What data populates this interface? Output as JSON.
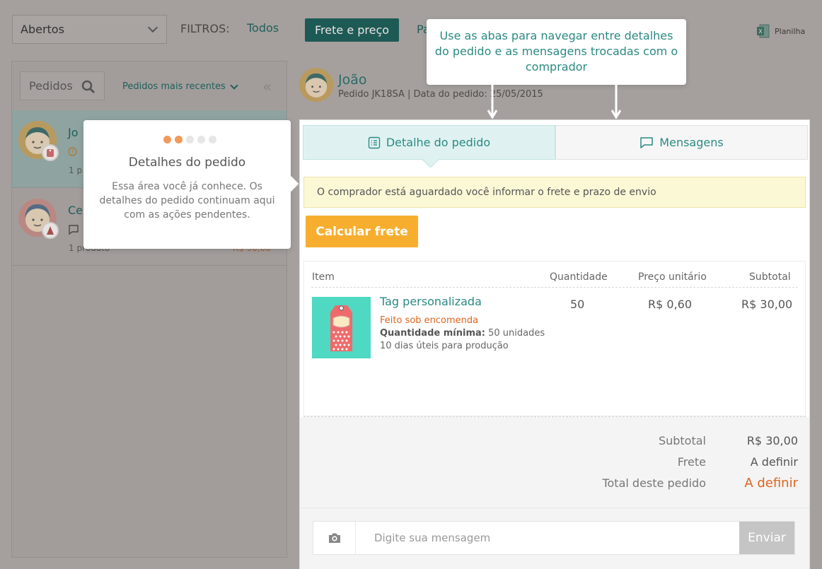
{
  "top_bar": {
    "status_select": "Abertos",
    "filters_label": "FILTROS:",
    "filter_all": "Todos",
    "filter_active": "Frete e preço",
    "filter_partial": "Pa",
    "spreadsheet_link": "Planilha"
  },
  "orders_panel": {
    "search_label": "Pedidos",
    "sort_label": "Pedidos mais recentes",
    "collapse_icon": "double-chevron-left-icon",
    "orders": [
      {
        "name_partial": "Jo",
        "status_icon": "?",
        "items_partial": "1 p",
        "price": ""
      },
      {
        "name_partial": "Ce",
        "status_icon": "chat-icon",
        "items_partial": "1 produto",
        "price": "R$ 90,00"
      }
    ]
  },
  "order_header": {
    "buyer_name": "João",
    "order_meta": "Pedido JK18SA | Data do pedido: 25/05/2015"
  },
  "tabs": {
    "details": "Detalhe do pedido",
    "messages": "Mensagens"
  },
  "notice": "O comprador está aguardado você informar o frete e prazo de envio",
  "calc_button": "Calcular frete",
  "table": {
    "headers": {
      "item": "Item",
      "quantity": "Quantidade",
      "unit_price": "Preço unitário",
      "subtotal": "Subtotal"
    },
    "rows": [
      {
        "name": "Tag personalizada",
        "made_to_order": "Feito sob encomenda",
        "min_label": "Quantidade mínima:",
        "min_value": "50 unidades",
        "production": "10 dias úteis para produção",
        "quantity": "50",
        "unit_price": "R$ 0,60",
        "subtotal": "R$ 30,00"
      }
    ]
  },
  "totals": {
    "subtotal_label": "Subtotal",
    "subtotal_value": "R$ 30,00",
    "shipping_label": "Frete",
    "shipping_value": "A definir",
    "total_label": "Total deste pedido",
    "total_value": "A definir"
  },
  "message": {
    "placeholder": "Digite sua mensagem",
    "send": "Enviar"
  },
  "tooltip_left": {
    "step": 2,
    "total_steps": 5,
    "title": "Detalhes do pedido",
    "body": "Essa área você já conhece. Os detalhes do pedido continuam aqui com as ações pendentes."
  },
  "tooltip_top": {
    "text": "Use as abas para navegar entre detalhes do pedido e as mensagens trocadas com o comprador"
  },
  "colors": {
    "accent": "#2b8a83",
    "warning": "#e0641e",
    "button": "#f7ae2e"
  }
}
